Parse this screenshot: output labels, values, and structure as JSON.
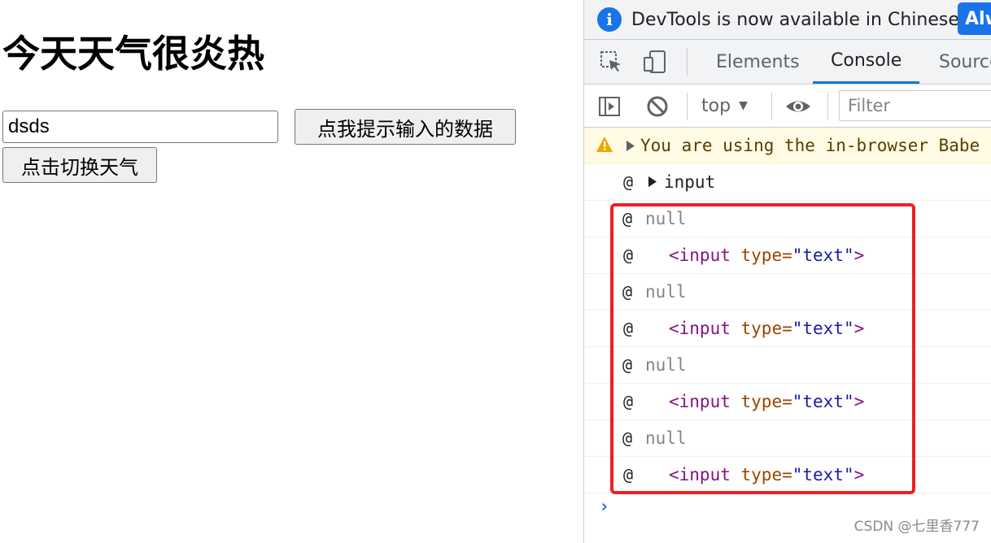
{
  "page": {
    "heading": "今天天气很炎热",
    "input_value": "dsds",
    "alert_button": "点我提示输入的数据",
    "toggle_button": "点击切换天气"
  },
  "devtools": {
    "infobar": {
      "message": "DevTools is now available in Chinese!",
      "button": "Alw"
    },
    "tabs": [
      "Elements",
      "Console",
      "Source"
    ],
    "active_tab": "Console",
    "toolbar": {
      "context": "top",
      "filter_placeholder": "Filter"
    },
    "console": {
      "warning": "You are using the in-browser Babe",
      "rows": [
        {
          "at": "@",
          "kind": "obj",
          "text": "input"
        },
        {
          "at": "@",
          "kind": "null",
          "text": "null"
        },
        {
          "at": "@",
          "kind": "el",
          "tag_open": "<input",
          "attr": "type",
          "eq": "=",
          "value": "\"text\"",
          "tag_close": ">"
        },
        {
          "at": "@",
          "kind": "null",
          "text": "null"
        },
        {
          "at": "@",
          "kind": "el",
          "tag_open": "<input",
          "attr": "type",
          "eq": "=",
          "value": "\"text\"",
          "tag_close": ">"
        },
        {
          "at": "@",
          "kind": "null",
          "text": "null"
        },
        {
          "at": "@",
          "kind": "el",
          "tag_open": "<input",
          "attr": "type",
          "eq": "=",
          "value": "\"text\"",
          "tag_close": ">"
        },
        {
          "at": "@",
          "kind": "null",
          "text": "null"
        },
        {
          "at": "@",
          "kind": "el",
          "tag_open": "<input",
          "attr": "type",
          "eq": "=",
          "value": "\"text\"",
          "tag_close": ">"
        }
      ],
      "prompt": "›"
    }
  },
  "watermark": "CSDN @七里香777",
  "colors": {
    "highlight": "#ee1f22",
    "accent": "#1a73e8",
    "warning_bg": "#fffbe5"
  },
  "icons": [
    "info-icon",
    "inspect-element-icon",
    "device-toolbar-icon",
    "sidebar-toggle-icon",
    "clear-console-icon",
    "dropdown-arrow-icon",
    "eye-icon",
    "warning-icon",
    "expand-triangle-icon",
    "prompt-chevron-icon"
  ]
}
